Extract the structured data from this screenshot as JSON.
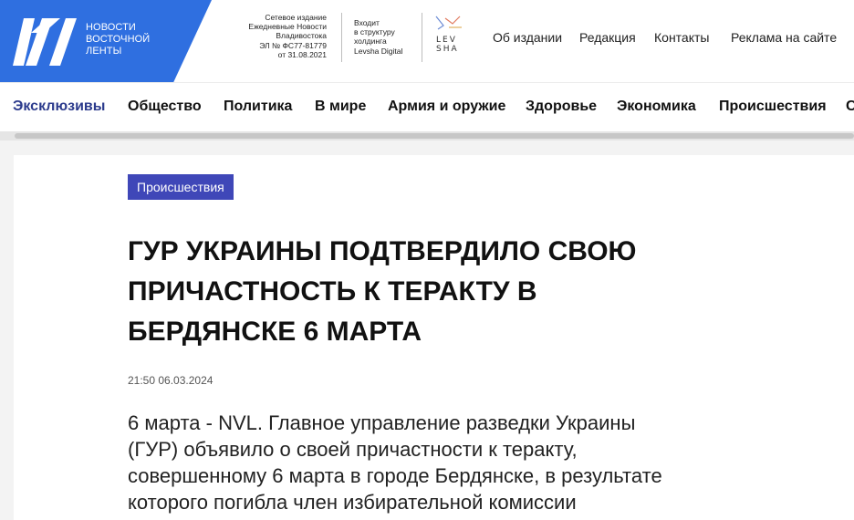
{
  "brand": {
    "logo_lines": [
      "НОВОСТИ",
      "ВОСТОЧНОЙ",
      "ЛЕНТЫ"
    ],
    "accent_color": "#2f6fe0"
  },
  "registration": {
    "lines": [
      "Сетевое издание",
      "Ежедневные Новости",
      "Владивостока",
      "ЭЛ № ФС77-81779",
      "от 31.08.2021"
    ]
  },
  "holding": {
    "lines": [
      "Входит",
      "в структуру",
      "холдинга",
      "Levsha Digital"
    ],
    "logo_text_top": "LEV",
    "logo_text_bottom": "SHA"
  },
  "top_nav": [
    "Об издании",
    "Редакция",
    "Контакты",
    "Реклама на сайте"
  ],
  "categories": [
    "Эксклюзивы",
    "Общество",
    "Политика",
    "В мире",
    "Армия и оружие",
    "Здоровье",
    "Экономика",
    "Происшествия",
    "С"
  ],
  "article": {
    "category": "Происшествия",
    "title_lines": [
      "ГУР Украины подтвердило свою",
      "причастность к теракту в",
      "Бердянске 6 марта"
    ],
    "datetime": "21:50 06.03.2024",
    "lead_lines": [
      "6 марта - NVL. Главное управление разведки Украины",
      "(ГУР) объявило о своей причастности к теракту,",
      "совершенному 6 марта в городе Бердянске, в результате",
      "которого погибла член избирательной комиссии"
    ],
    "badge_color": "#3f47b8"
  }
}
